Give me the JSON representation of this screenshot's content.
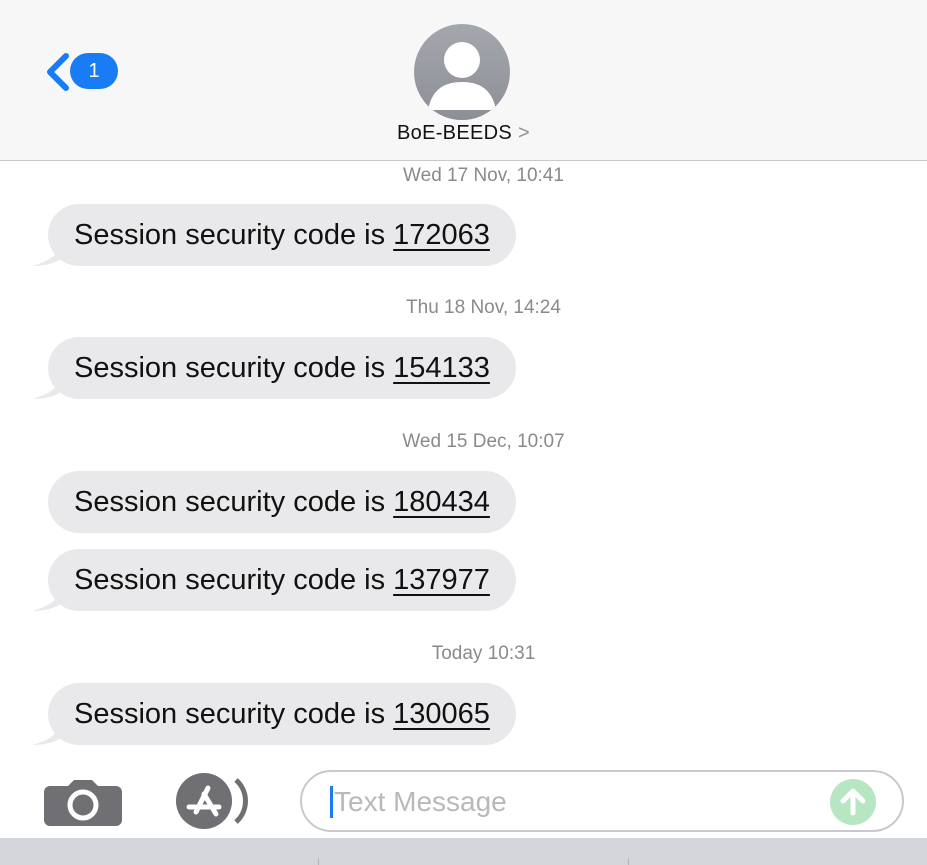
{
  "header": {
    "back_badge_count": "1",
    "contact_name": "BoE-BEEDS",
    "contact_chevron": ">",
    "accent_color": "#1a7cf5"
  },
  "thread": {
    "timestamps": [
      "Wed 17 Nov, 10:41",
      "Thu 18 Nov, 14:24",
      "Wed 15 Dec, 10:07",
      "Today 10:31"
    ],
    "messages": [
      {
        "prefix": "Session security code is ",
        "code": "172063"
      },
      {
        "prefix": "Session security code is ",
        "code": "154133"
      },
      {
        "prefix": "Session security code is ",
        "code": "180434"
      },
      {
        "prefix": "Session security code is ",
        "code": "137977"
      },
      {
        "prefix": "Session security code is ",
        "code": "130065"
      }
    ]
  },
  "composer": {
    "placeholder": "Text Message",
    "value": "",
    "camera_icon": "camera-icon",
    "apps_icon": "app-store-icon",
    "send_icon": "send-arrow-up-icon"
  }
}
